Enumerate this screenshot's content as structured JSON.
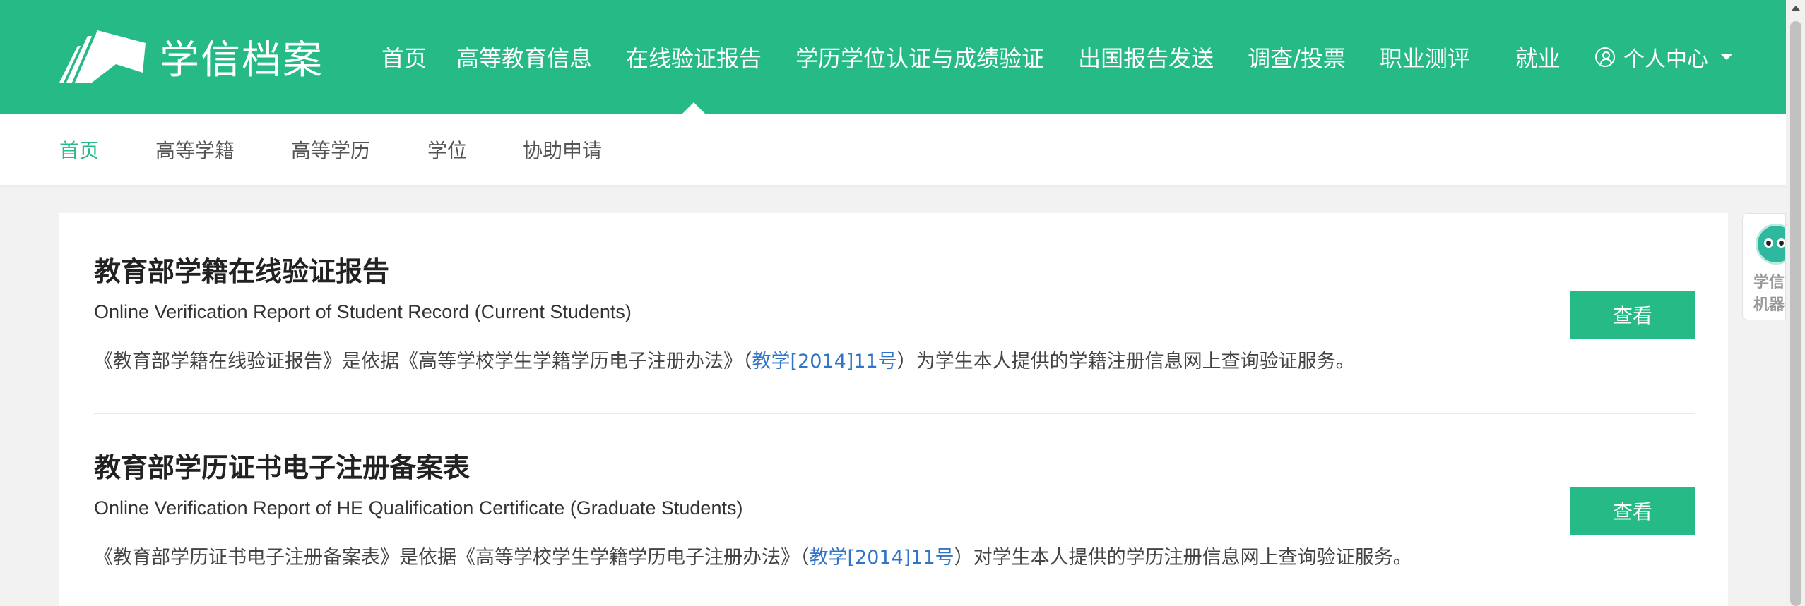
{
  "header": {
    "logo_text": "学信档案",
    "nav": [
      {
        "label": "首页"
      },
      {
        "label": "高等教育信息"
      },
      {
        "label": "在线验证报告"
      },
      {
        "label": "学历学位认证与成绩验证"
      },
      {
        "label": "出国报告发送"
      },
      {
        "label": "调查/投票"
      },
      {
        "label": "职业测评"
      },
      {
        "label": "就业"
      }
    ],
    "active_nav": "在线验证报告",
    "user_menu_label": "个人中心"
  },
  "subnav": {
    "items": [
      {
        "label": "首页"
      },
      {
        "label": "高等学籍"
      },
      {
        "label": "高等学历"
      },
      {
        "label": "学位"
      },
      {
        "label": "协助申请"
      }
    ],
    "active": "首页"
  },
  "reports": [
    {
      "title": "教育部学籍在线验证报告",
      "subtitle": "Online Verification Report of Student Record (Current Students)",
      "desc_before": "《教育部学籍在线验证报告》是依据《高等学校学生学籍学历电子注册办法》（",
      "desc_link": "教学[2014]11号",
      "desc_after": "）为学生本人提供的学籍注册信息网上查询验证服务。",
      "button_label": "查看"
    },
    {
      "title": "教育部学历证书电子注册备案表",
      "subtitle": "Online Verification Report of HE Qualification Certificate (Graduate Students)",
      "desc_before": "《教育部学历证书电子注册备案表》是依据《高等学校学生学籍学历电子注册办法》（",
      "desc_link": "教学[2014]11号",
      "desc_after": "）对学生本人提供的学历注册信息网上查询验证服务。",
      "button_label": "查看"
    }
  ],
  "robot_widget": {
    "label_line1": "学信",
    "label_line2": "机器"
  },
  "colors": {
    "brand": "#26bb86",
    "link": "#2f74c6"
  }
}
